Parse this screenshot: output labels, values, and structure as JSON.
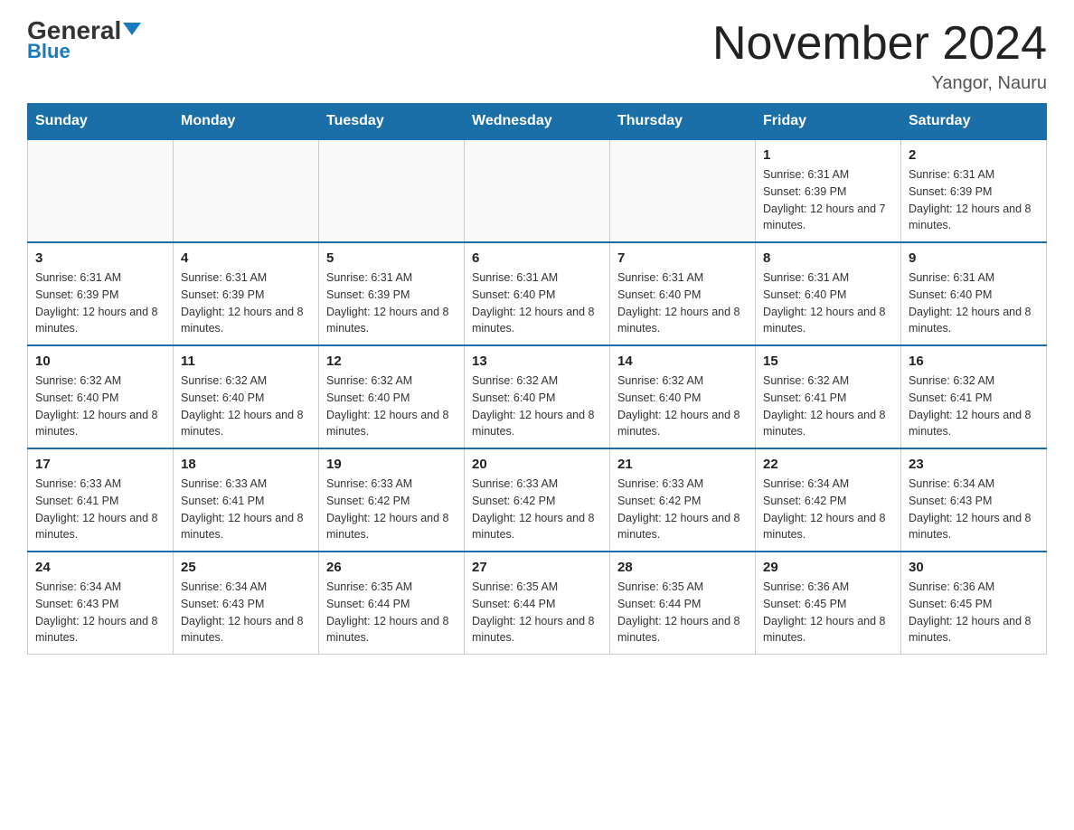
{
  "logo": {
    "general": "General",
    "blue": "Blue"
  },
  "title": "November 2024",
  "subtitle": "Yangor, Nauru",
  "days_of_week": [
    "Sunday",
    "Monday",
    "Tuesday",
    "Wednesday",
    "Thursday",
    "Friday",
    "Saturday"
  ],
  "weeks": [
    [
      {
        "day": "",
        "sunrise": "",
        "sunset": "",
        "daylight": ""
      },
      {
        "day": "",
        "sunrise": "",
        "sunset": "",
        "daylight": ""
      },
      {
        "day": "",
        "sunrise": "",
        "sunset": "",
        "daylight": ""
      },
      {
        "day": "",
        "sunrise": "",
        "sunset": "",
        "daylight": ""
      },
      {
        "day": "",
        "sunrise": "",
        "sunset": "",
        "daylight": ""
      },
      {
        "day": "1",
        "sunrise": "Sunrise: 6:31 AM",
        "sunset": "Sunset: 6:39 PM",
        "daylight": "Daylight: 12 hours and 7 minutes."
      },
      {
        "day": "2",
        "sunrise": "Sunrise: 6:31 AM",
        "sunset": "Sunset: 6:39 PM",
        "daylight": "Daylight: 12 hours and 8 minutes."
      }
    ],
    [
      {
        "day": "3",
        "sunrise": "Sunrise: 6:31 AM",
        "sunset": "Sunset: 6:39 PM",
        "daylight": "Daylight: 12 hours and 8 minutes."
      },
      {
        "day": "4",
        "sunrise": "Sunrise: 6:31 AM",
        "sunset": "Sunset: 6:39 PM",
        "daylight": "Daylight: 12 hours and 8 minutes."
      },
      {
        "day": "5",
        "sunrise": "Sunrise: 6:31 AM",
        "sunset": "Sunset: 6:39 PM",
        "daylight": "Daylight: 12 hours and 8 minutes."
      },
      {
        "day": "6",
        "sunrise": "Sunrise: 6:31 AM",
        "sunset": "Sunset: 6:40 PM",
        "daylight": "Daylight: 12 hours and 8 minutes."
      },
      {
        "day": "7",
        "sunrise": "Sunrise: 6:31 AM",
        "sunset": "Sunset: 6:40 PM",
        "daylight": "Daylight: 12 hours and 8 minutes."
      },
      {
        "day": "8",
        "sunrise": "Sunrise: 6:31 AM",
        "sunset": "Sunset: 6:40 PM",
        "daylight": "Daylight: 12 hours and 8 minutes."
      },
      {
        "day": "9",
        "sunrise": "Sunrise: 6:31 AM",
        "sunset": "Sunset: 6:40 PM",
        "daylight": "Daylight: 12 hours and 8 minutes."
      }
    ],
    [
      {
        "day": "10",
        "sunrise": "Sunrise: 6:32 AM",
        "sunset": "Sunset: 6:40 PM",
        "daylight": "Daylight: 12 hours and 8 minutes."
      },
      {
        "day": "11",
        "sunrise": "Sunrise: 6:32 AM",
        "sunset": "Sunset: 6:40 PM",
        "daylight": "Daylight: 12 hours and 8 minutes."
      },
      {
        "day": "12",
        "sunrise": "Sunrise: 6:32 AM",
        "sunset": "Sunset: 6:40 PM",
        "daylight": "Daylight: 12 hours and 8 minutes."
      },
      {
        "day": "13",
        "sunrise": "Sunrise: 6:32 AM",
        "sunset": "Sunset: 6:40 PM",
        "daylight": "Daylight: 12 hours and 8 minutes."
      },
      {
        "day": "14",
        "sunrise": "Sunrise: 6:32 AM",
        "sunset": "Sunset: 6:40 PM",
        "daylight": "Daylight: 12 hours and 8 minutes."
      },
      {
        "day": "15",
        "sunrise": "Sunrise: 6:32 AM",
        "sunset": "Sunset: 6:41 PM",
        "daylight": "Daylight: 12 hours and 8 minutes."
      },
      {
        "day": "16",
        "sunrise": "Sunrise: 6:32 AM",
        "sunset": "Sunset: 6:41 PM",
        "daylight": "Daylight: 12 hours and 8 minutes."
      }
    ],
    [
      {
        "day": "17",
        "sunrise": "Sunrise: 6:33 AM",
        "sunset": "Sunset: 6:41 PM",
        "daylight": "Daylight: 12 hours and 8 minutes."
      },
      {
        "day": "18",
        "sunrise": "Sunrise: 6:33 AM",
        "sunset": "Sunset: 6:41 PM",
        "daylight": "Daylight: 12 hours and 8 minutes."
      },
      {
        "day": "19",
        "sunrise": "Sunrise: 6:33 AM",
        "sunset": "Sunset: 6:42 PM",
        "daylight": "Daylight: 12 hours and 8 minutes."
      },
      {
        "day": "20",
        "sunrise": "Sunrise: 6:33 AM",
        "sunset": "Sunset: 6:42 PM",
        "daylight": "Daylight: 12 hours and 8 minutes."
      },
      {
        "day": "21",
        "sunrise": "Sunrise: 6:33 AM",
        "sunset": "Sunset: 6:42 PM",
        "daylight": "Daylight: 12 hours and 8 minutes."
      },
      {
        "day": "22",
        "sunrise": "Sunrise: 6:34 AM",
        "sunset": "Sunset: 6:42 PM",
        "daylight": "Daylight: 12 hours and 8 minutes."
      },
      {
        "day": "23",
        "sunrise": "Sunrise: 6:34 AM",
        "sunset": "Sunset: 6:43 PM",
        "daylight": "Daylight: 12 hours and 8 minutes."
      }
    ],
    [
      {
        "day": "24",
        "sunrise": "Sunrise: 6:34 AM",
        "sunset": "Sunset: 6:43 PM",
        "daylight": "Daylight: 12 hours and 8 minutes."
      },
      {
        "day": "25",
        "sunrise": "Sunrise: 6:34 AM",
        "sunset": "Sunset: 6:43 PM",
        "daylight": "Daylight: 12 hours and 8 minutes."
      },
      {
        "day": "26",
        "sunrise": "Sunrise: 6:35 AM",
        "sunset": "Sunset: 6:44 PM",
        "daylight": "Daylight: 12 hours and 8 minutes."
      },
      {
        "day": "27",
        "sunrise": "Sunrise: 6:35 AM",
        "sunset": "Sunset: 6:44 PM",
        "daylight": "Daylight: 12 hours and 8 minutes."
      },
      {
        "day": "28",
        "sunrise": "Sunrise: 6:35 AM",
        "sunset": "Sunset: 6:44 PM",
        "daylight": "Daylight: 12 hours and 8 minutes."
      },
      {
        "day": "29",
        "sunrise": "Sunrise: 6:36 AM",
        "sunset": "Sunset: 6:45 PM",
        "daylight": "Daylight: 12 hours and 8 minutes."
      },
      {
        "day": "30",
        "sunrise": "Sunrise: 6:36 AM",
        "sunset": "Sunset: 6:45 PM",
        "daylight": "Daylight: 12 hours and 8 minutes."
      }
    ]
  ]
}
